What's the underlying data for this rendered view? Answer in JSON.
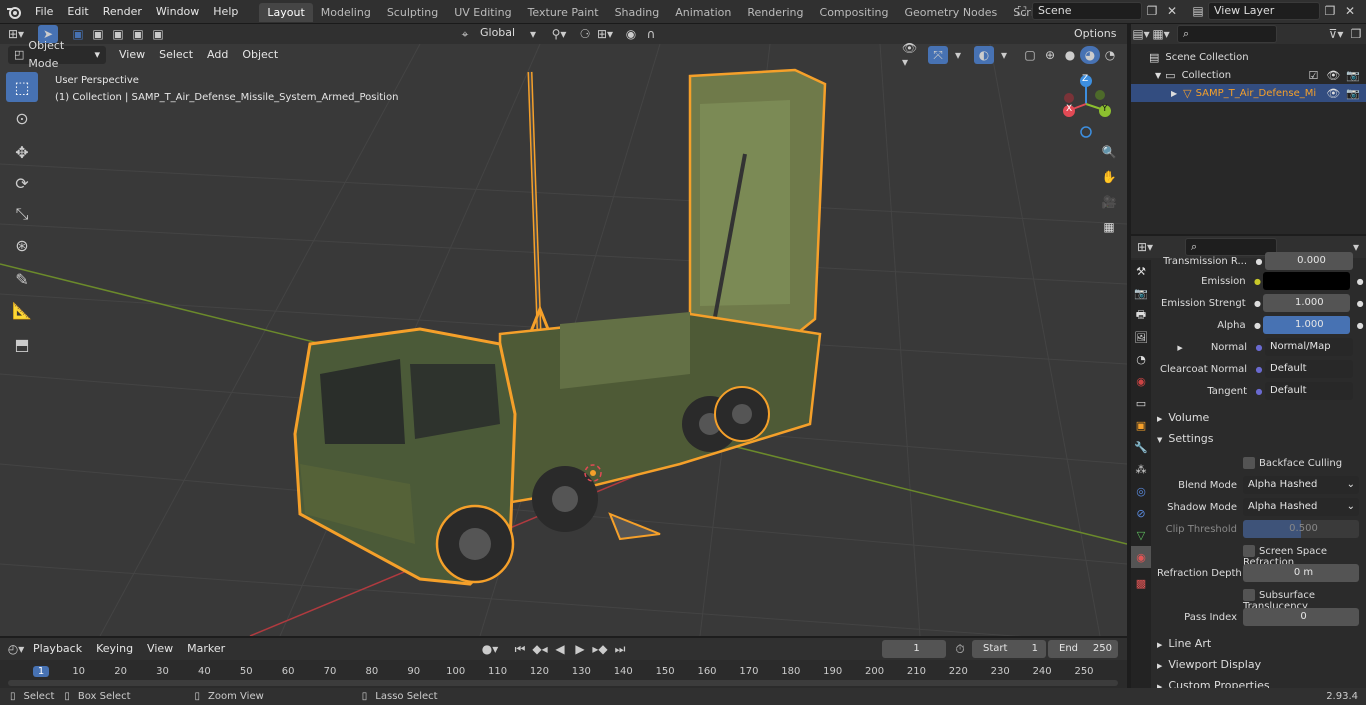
{
  "menus": [
    "File",
    "Edit",
    "Render",
    "Window",
    "Help"
  ],
  "workspaces": [
    "Layout",
    "Modeling",
    "Sculpting",
    "UV Editing",
    "Texture Paint",
    "Shading",
    "Animation",
    "Rendering",
    "Compositing",
    "Geometry Nodes",
    "Scripting"
  ],
  "active_workspace": "Layout",
  "scene": {
    "name": "Scene",
    "view_layer": "View Layer"
  },
  "header": {
    "transform_orientation": "Global",
    "options": "Options"
  },
  "viewport_header": {
    "mode": "Object Mode",
    "menus": [
      "View",
      "Select",
      "Add",
      "Object"
    ]
  },
  "overlay_text": {
    "perspective": "User Perspective",
    "collection": "(1) Collection | SAMP_T_Air_Defense_Missile_System_Armed_Position"
  },
  "gizmo": {
    "x": "X",
    "y": "Y",
    "z": "Z"
  },
  "outliner": {
    "root": "Scene Collection",
    "collection": "Collection",
    "object": "SAMP_T_Air_Defense_Mi"
  },
  "properties": {
    "rows": [
      {
        "label": "Transmission R...",
        "value": "0.000"
      },
      {
        "label": "Emission",
        "value": ""
      },
      {
        "label": "Emission Strengt",
        "value": "1.000"
      },
      {
        "label": "Alpha",
        "value": "1.000"
      },
      {
        "label": "Normal",
        "value": "Normal/Map"
      },
      {
        "label": "Clearcoat Normal",
        "value": "Default"
      },
      {
        "label": "Tangent",
        "value": "Default"
      }
    ],
    "section_volume": "Volume",
    "section_settings": "Settings",
    "backface_culling": "Backface Culling",
    "blend_mode_label": "Blend Mode",
    "blend_mode": "Alpha Hashed",
    "shadow_mode_label": "Shadow Mode",
    "shadow_mode": "Alpha Hashed",
    "clip_threshold_label": "Clip Threshold",
    "clip_threshold": "0.500",
    "screen_space_refraction": "Screen Space Refraction",
    "refraction_depth_label": "Refraction Depth",
    "refraction_depth": "0 m",
    "subsurface_translucency": "Subsurface Translucency",
    "pass_index_label": "Pass Index",
    "pass_index": "0",
    "section_line_art": "Line Art",
    "section_viewport_display": "Viewport Display",
    "section_custom_properties": "Custom Properties"
  },
  "timeline": {
    "menus": [
      "Playback",
      "Keying",
      "View",
      "Marker"
    ],
    "current_frame": "1",
    "start_label": "Start",
    "start": "1",
    "end_label": "End",
    "end": "250",
    "ticks": [
      "1",
      "10",
      "20",
      "30",
      "40",
      "50",
      "60",
      "70",
      "80",
      "90",
      "100",
      "110",
      "120",
      "130",
      "140",
      "150",
      "160",
      "170",
      "180",
      "190",
      "200",
      "210",
      "220",
      "230",
      "240",
      "250"
    ]
  },
  "statusbar": {
    "select": "Select",
    "box_select": "Box Select",
    "zoom_view": "Zoom View",
    "lasso_select": "Lasso Select",
    "version": "2.93.4"
  },
  "colors": {
    "accent": "#4772b3",
    "selection_outline": "#f5a02a",
    "x_axis": "#e24a55",
    "y_axis": "#8cbf2f",
    "z_axis": "#3d8fe0"
  }
}
